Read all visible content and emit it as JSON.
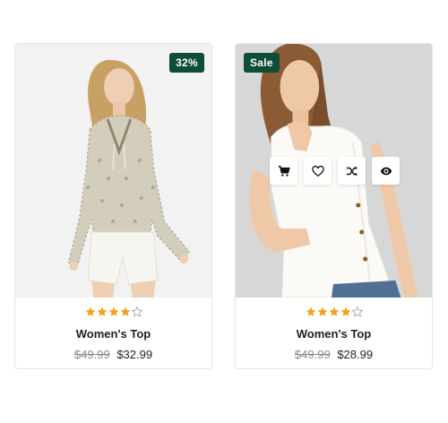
{
  "products": [
    {
      "badge": "32%",
      "badge_color": "#0f4d34",
      "rating": 4,
      "rating_max": 5,
      "title": "Women's Top",
      "old_price": "$49.99",
      "new_price": "$32.99"
    },
    {
      "badge": "Sale",
      "badge_color": "#0f4d34",
      "rating": 4,
      "rating_max": 5,
      "title": "Women's Top",
      "old_price": "$49.99",
      "new_price": "$28.99",
      "actions": [
        {
          "icon": "cart-icon"
        },
        {
          "icon": "heart-icon"
        },
        {
          "icon": "shuffle-icon"
        },
        {
          "icon": "eye-icon"
        }
      ]
    }
  ],
  "colors": {
    "star_filled": "#f3a21b",
    "star_empty": "#a8a8a8",
    "accent": "#0f4d34"
  }
}
